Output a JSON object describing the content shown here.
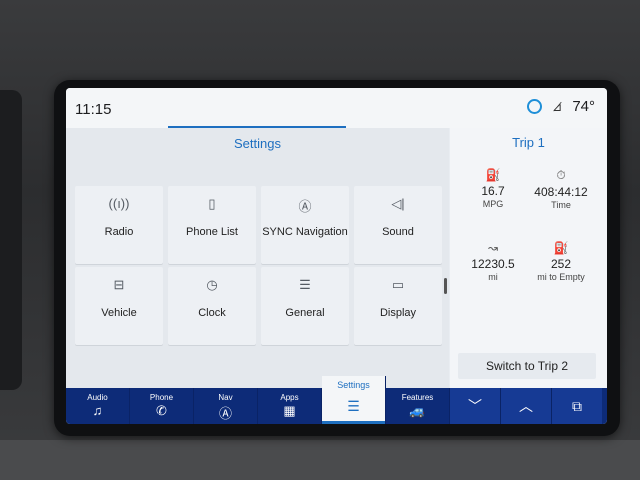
{
  "status": {
    "time": "11:15",
    "temperature": "74°",
    "icons": [
      "assistant-ring-icon",
      "signal-off-icon"
    ]
  },
  "settings": {
    "title": "Settings",
    "tiles": [
      {
        "label": "Radio",
        "icon": "radio-antenna-icon",
        "glyph": "((ı))"
      },
      {
        "label": "Phone List",
        "icon": "phone-list-icon",
        "glyph": "▯"
      },
      {
        "label": "SYNC Navigation",
        "icon": "navigation-icon",
        "glyph": "Ⓐ"
      },
      {
        "label": "Sound",
        "icon": "speaker-icon",
        "glyph": "◁|"
      },
      {
        "label": "Vehicle",
        "icon": "vehicle-settings-icon",
        "glyph": "⊟"
      },
      {
        "label": "Clock",
        "icon": "clock-icon",
        "glyph": "◷"
      },
      {
        "label": "General",
        "icon": "sliders-icon",
        "glyph": "☰"
      },
      {
        "label": "Display",
        "icon": "display-icon",
        "glyph": "▭"
      }
    ],
    "page_dots": 2,
    "active_page": 1
  },
  "trip": {
    "title": "Trip 1",
    "stats": [
      {
        "value": "16.7",
        "unit": "MPG",
        "icon": "fuel-economy-icon",
        "glyph": "⛽"
      },
      {
        "value": "408:44:12",
        "unit": "Time",
        "icon": "stopwatch-icon",
        "glyph": "⏱"
      },
      {
        "value": "12230.5",
        "unit": "mi",
        "icon": "distance-icon",
        "glyph": "↝"
      },
      {
        "value": "252",
        "unit": "mi to Empty",
        "icon": "fuel-range-icon",
        "glyph": "⛽"
      }
    ],
    "switch_label": "Switch to Trip 2"
  },
  "nav": {
    "items": [
      {
        "label": "Audio",
        "icon": "music-note-icon",
        "glyph": "♫"
      },
      {
        "label": "Phone",
        "icon": "phone-icon",
        "glyph": "✆"
      },
      {
        "label": "Nav",
        "icon": "navigation-icon",
        "glyph": "Ⓐ"
      },
      {
        "label": "Apps",
        "icon": "apps-grid-icon",
        "glyph": "▦"
      },
      {
        "label": "Settings",
        "icon": "sliders-icon",
        "glyph": "☰"
      },
      {
        "label": "Features",
        "icon": "features-car-icon",
        "glyph": "🚙"
      }
    ],
    "active": "Settings",
    "controls": [
      {
        "icon": "chevron-down-icon",
        "glyph": "﹀"
      },
      {
        "icon": "chevron-up-icon",
        "glyph": "︿"
      },
      {
        "icon": "copy-windows-icon",
        "glyph": "⧉"
      }
    ]
  },
  "colors": {
    "accent": "#1e6fc0",
    "nav_background": "#0d2b78",
    "assistant_ring": "#1e8fd8"
  }
}
